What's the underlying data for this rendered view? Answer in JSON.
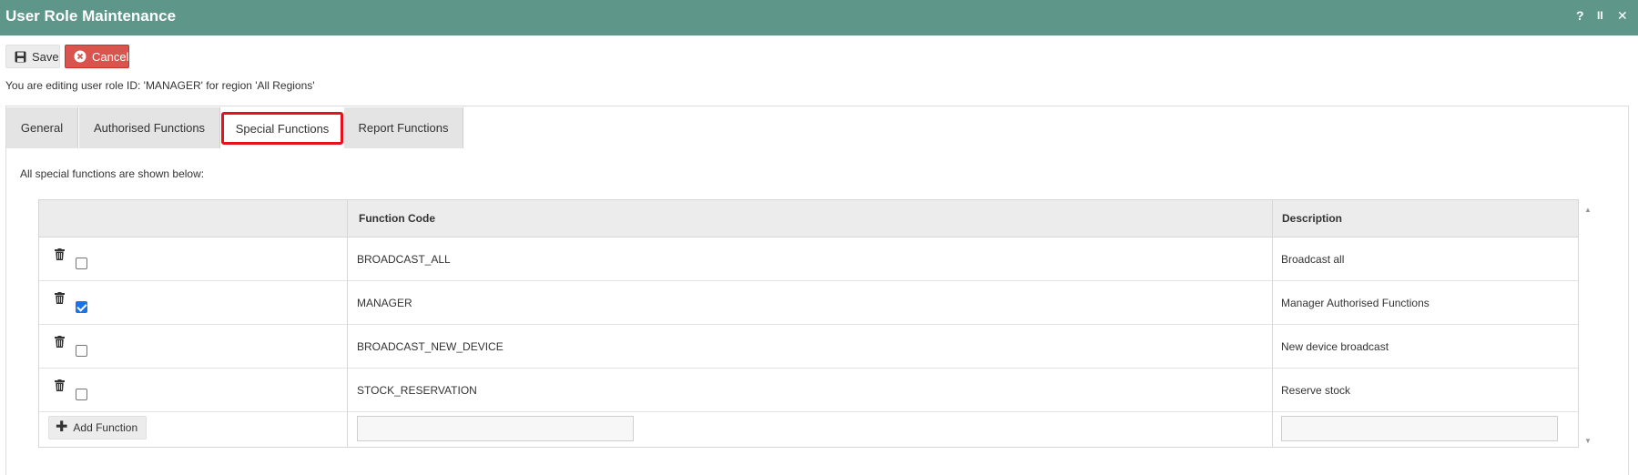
{
  "window": {
    "title": "User Role Maintenance",
    "help": "?",
    "pause": "II",
    "close": "✕"
  },
  "toolbar": {
    "save_label": "Save",
    "cancel_label": "Cancel"
  },
  "edit_info": "You are editing user role ID: 'MANAGER' for region 'All Regions'",
  "tabs": [
    {
      "label": "General"
    },
    {
      "label": "Authorised Functions"
    },
    {
      "label": "Special Functions"
    },
    {
      "label": "Report Functions"
    }
  ],
  "active_tab": "Special Functions",
  "intro_text": "All special functions are shown below:",
  "grid": {
    "columns": [
      "",
      "Function Code",
      "Description"
    ],
    "rows": [
      {
        "code": "BROADCAST_ALL",
        "description": "Broadcast all",
        "checked": false
      },
      {
        "code": "MANAGER",
        "description": "Manager Authorised Functions",
        "checked": true
      },
      {
        "code": "BROADCAST_NEW_DEVICE",
        "description": "New device broadcast",
        "checked": false
      },
      {
        "code": "STOCK_RESERVATION",
        "description": "Reserve stock",
        "checked": false
      }
    ],
    "add_label": "Add Function",
    "new_code_value": "",
    "new_description_value": ""
  },
  "colors": {
    "titlebar": "#5e978a",
    "cancel": "#d9534f",
    "highlight": "#e8101a",
    "checkbox": "#1a73e8"
  },
  "icons": {
    "save": "floppy-disk-icon",
    "cancel": "x-circle-icon",
    "delete": "trash-icon",
    "add": "plus-icon"
  }
}
